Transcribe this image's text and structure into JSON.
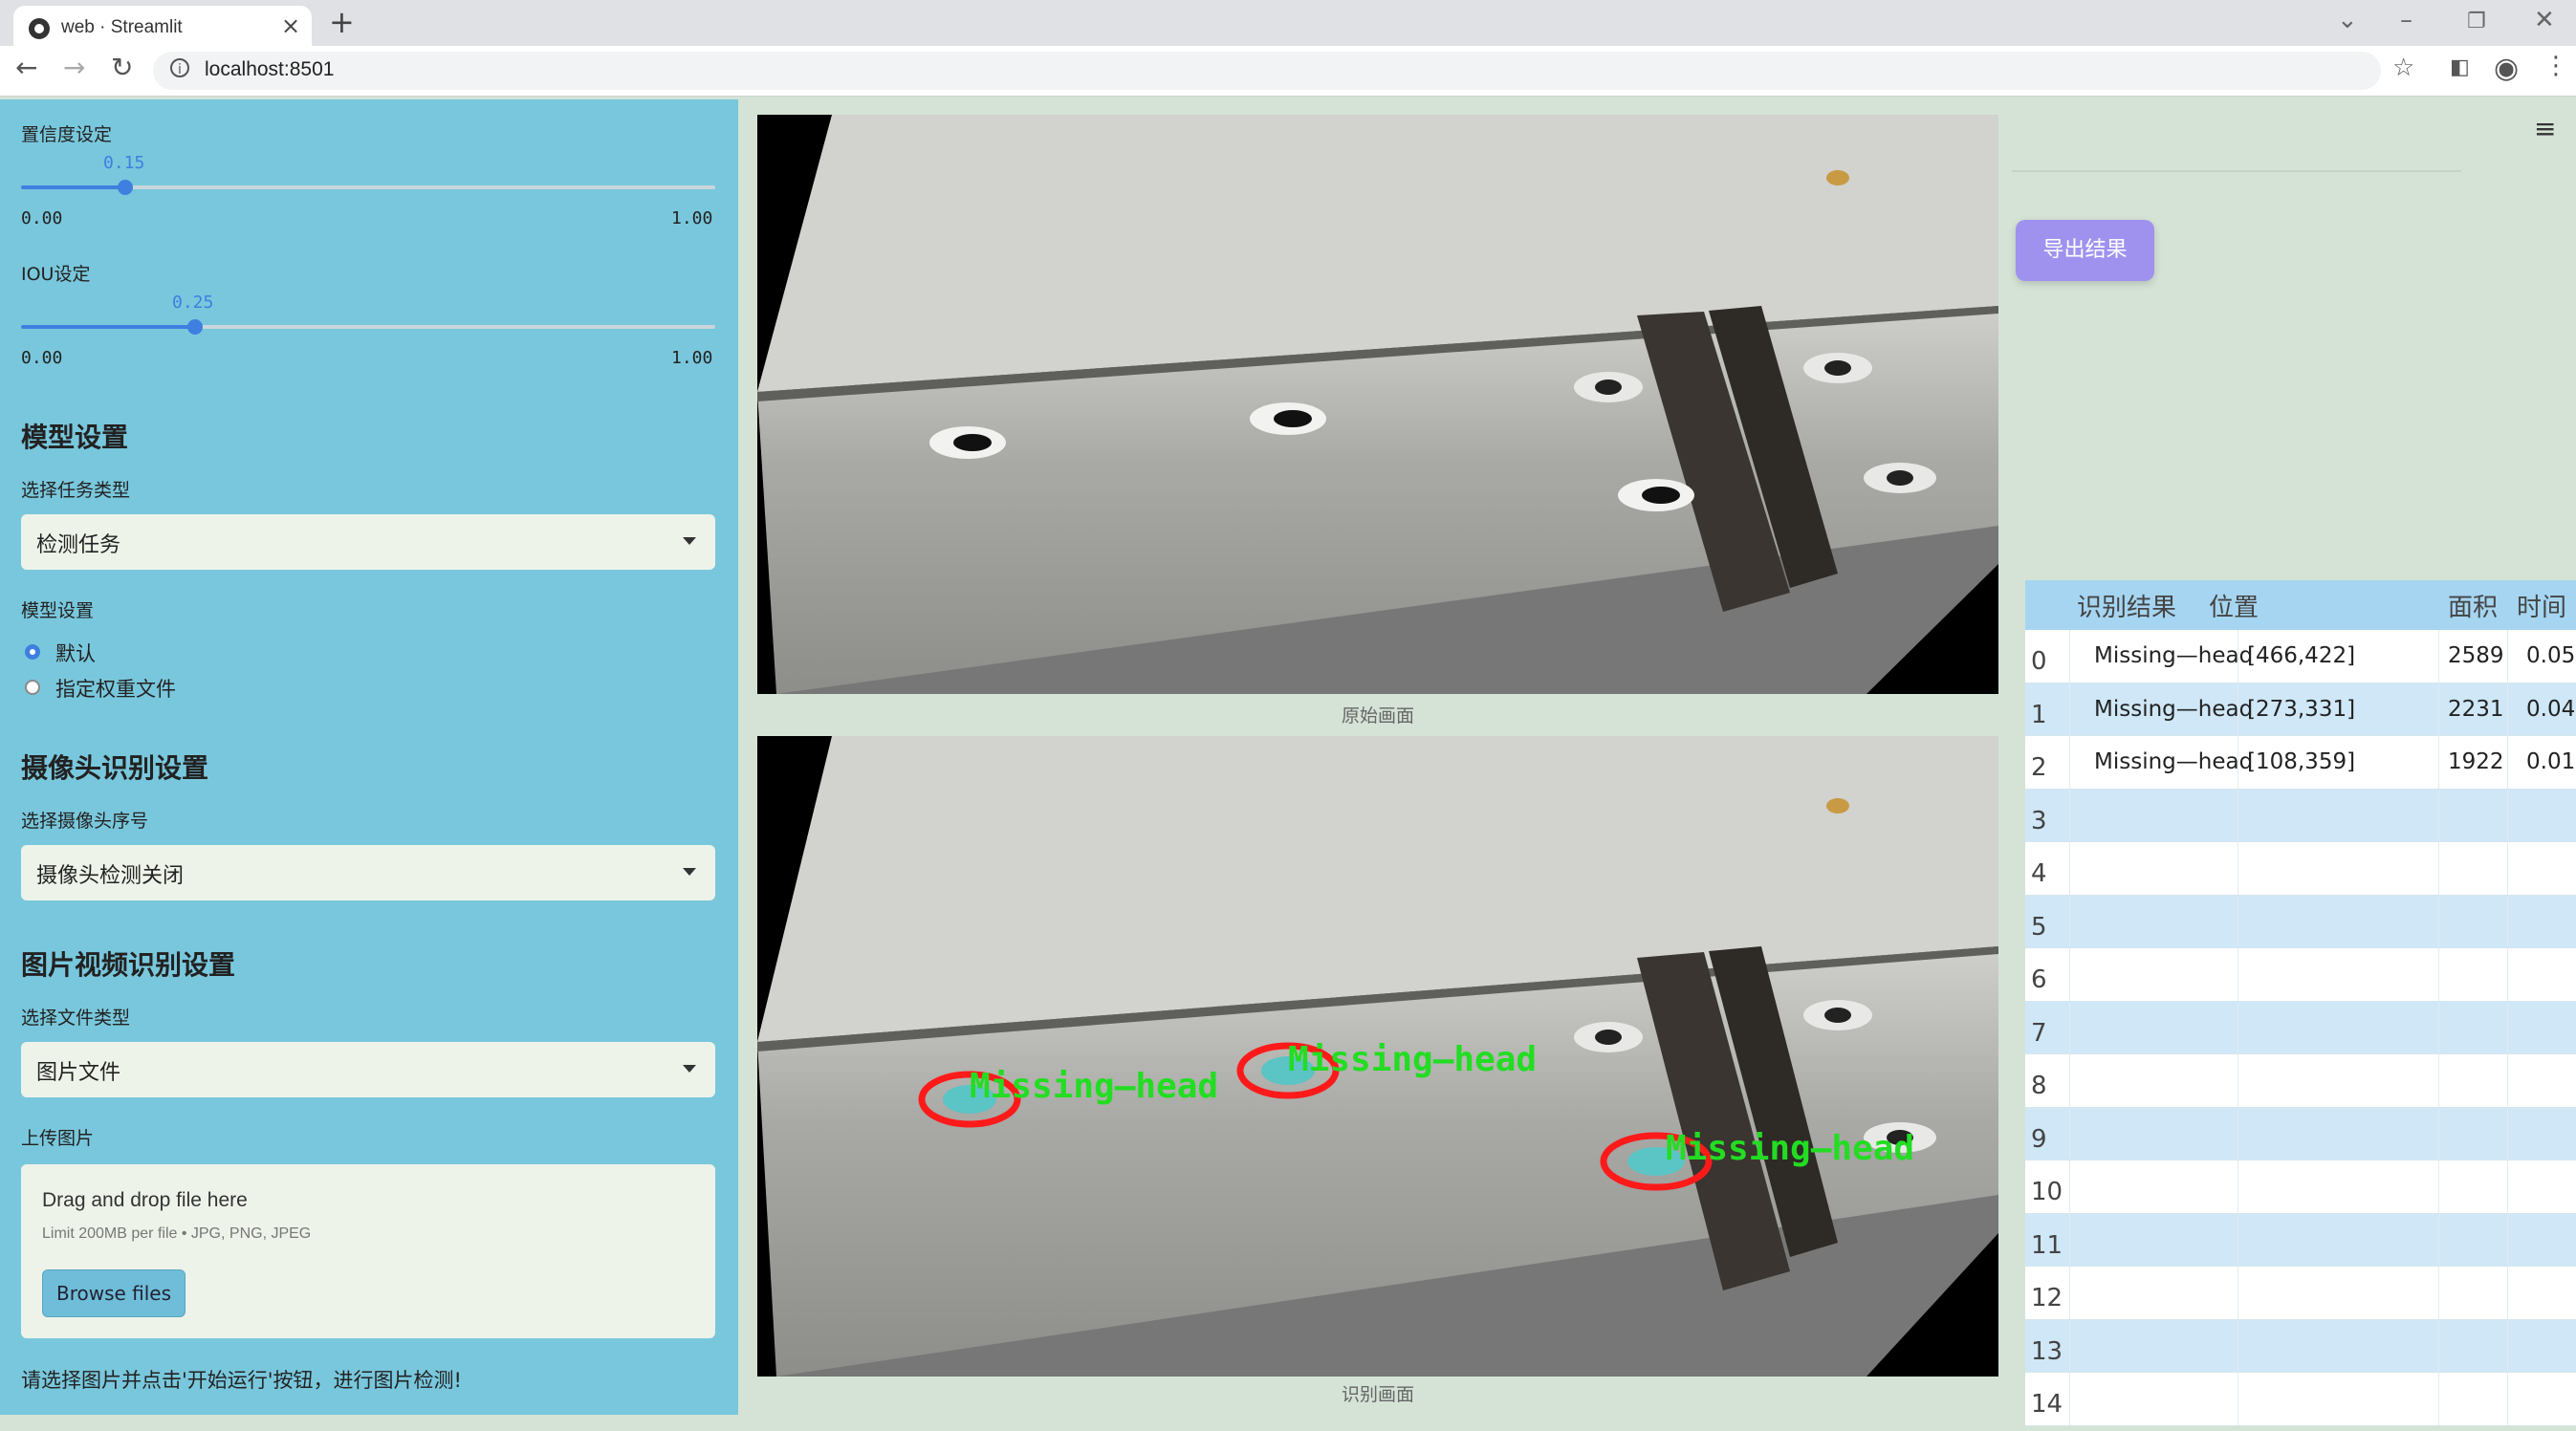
{
  "browser": {
    "tab_title": "web · Streamlit",
    "url": "localhost:8501"
  },
  "sidebar": {
    "confidence": {
      "label": "置信度设定",
      "value": "0.15",
      "min": "0.00",
      "max": "1.00",
      "fraction": 0.15
    },
    "iou": {
      "label": "IOU设定",
      "value": "0.25",
      "min": "0.00",
      "max": "1.00",
      "fraction": 0.25
    },
    "model_section": {
      "heading": "模型设置",
      "task_label": "选择任务类型",
      "task_value": "检测任务",
      "model_label": "模型设置",
      "options": [
        "默认",
        "指定权重文件"
      ],
      "selected": 0
    },
    "camera_section": {
      "heading": "摄像头识别设置",
      "label": "选择摄像头序号",
      "value": "摄像头检测关闭"
    },
    "media_section": {
      "heading": "图片视频识别设置",
      "file_type_label": "选择文件类型",
      "file_type_value": "图片文件",
      "upload_label": "上传图片",
      "drop_text": "Drag and drop file here",
      "limit_text": "Limit 200MB per file • JPG, PNG, JPEG",
      "browse_label": "Browse files"
    },
    "hint": "请选择图片并点击'开始运行'按钮，进行图片检测!"
  },
  "main": {
    "original_caption": "原始画面",
    "result_caption": "识别画面",
    "detection_label": "Missing—head"
  },
  "right": {
    "export_label": "导出结果",
    "table": {
      "headers": [
        "识别结果",
        "位置",
        "面积",
        "时间"
      ],
      "rows": [
        {
          "idx": "0",
          "result": "Missing—head",
          "pos": "[466,422]",
          "area": "2589",
          "time": "0.05"
        },
        {
          "idx": "1",
          "result": "Missing—head",
          "pos": "[273,331]",
          "area": "2231",
          "time": "0.04"
        },
        {
          "idx": "2",
          "result": "Missing—head",
          "pos": "[108,359]",
          "area": "1922",
          "time": "0.01"
        },
        {
          "idx": "3"
        },
        {
          "idx": "4"
        },
        {
          "idx": "5"
        },
        {
          "idx": "6"
        },
        {
          "idx": "7"
        },
        {
          "idx": "8"
        },
        {
          "idx": "9"
        },
        {
          "idx": "10"
        },
        {
          "idx": "11"
        },
        {
          "idx": "12"
        },
        {
          "idx": "13"
        },
        {
          "idx": "14"
        }
      ]
    }
  },
  "colors": {
    "sidebar": "#79c7dc",
    "main_bg": "#d4e3d6",
    "accent": "#3f7fe0",
    "export_button": "#9f92ef",
    "detection_box": "#ff1a1a",
    "detection_text": "#22dd22"
  }
}
